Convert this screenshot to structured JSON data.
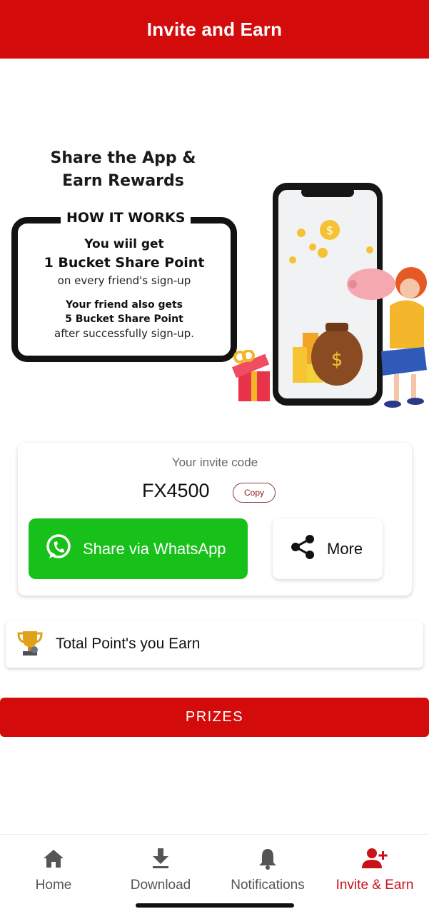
{
  "appbar": {
    "title": "Invite and Earn"
  },
  "banner": {
    "heading_line1": "Share the App &",
    "heading_line2": "Earn Rewards",
    "how_title": "HOW IT WORKS",
    "line1": "You wiil get",
    "line2": "1 Bucket Share Point",
    "line3": "on every friend's sign-up",
    "line4": "Your friend also gets",
    "line5": "5 Bucket Share Point",
    "line6": "after successfully sign-up."
  },
  "invite": {
    "label": "Your invite code",
    "code": "FX4500",
    "copy_label": "Copy",
    "whatsapp_label": "Share via WhatsApp",
    "more_label": "More"
  },
  "points": {
    "label": "Total Point's you Earn"
  },
  "prizes": {
    "label": "PRIZES"
  },
  "nav": {
    "items": [
      {
        "label": "Home",
        "icon": "home-icon"
      },
      {
        "label": "Download",
        "icon": "download-icon"
      },
      {
        "label": "Notifications",
        "icon": "bell-icon"
      },
      {
        "label": "Invite & Earn",
        "icon": "person-add-icon"
      }
    ],
    "active_index": 3
  },
  "colors": {
    "brand_red": "#d30b0b",
    "whatsapp_green": "#18c01a",
    "active_nav": "#c8121a"
  }
}
